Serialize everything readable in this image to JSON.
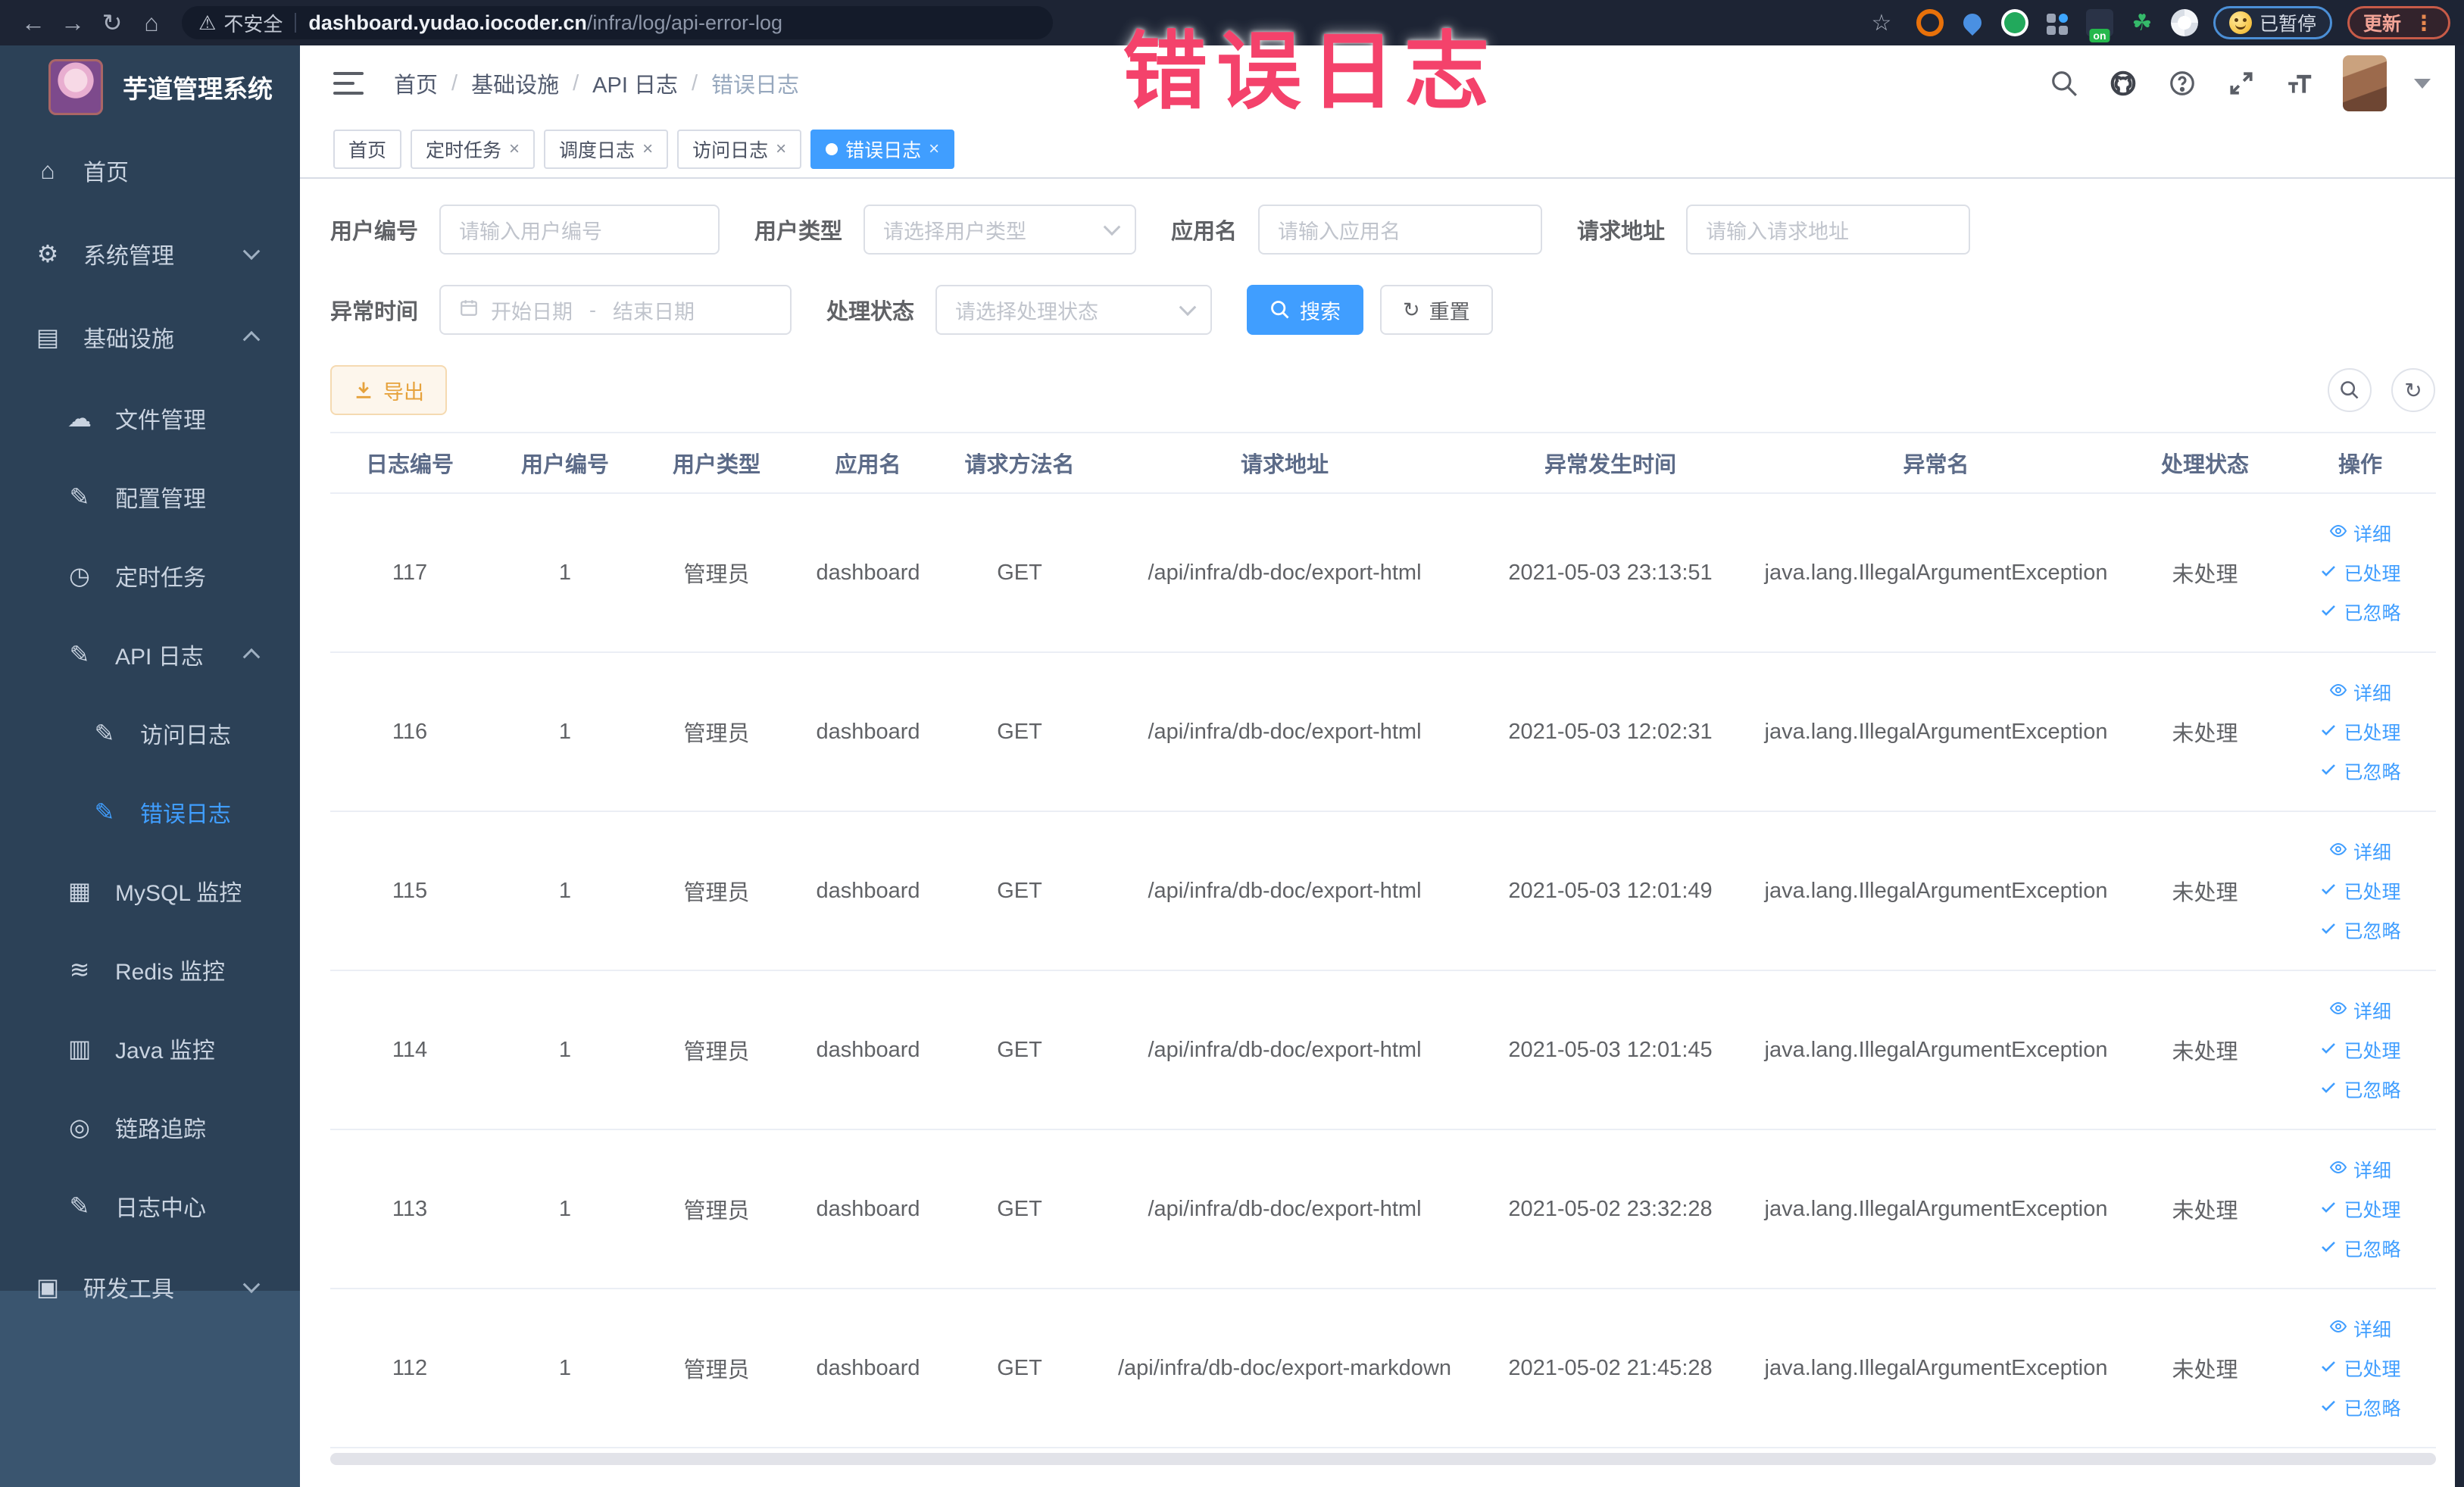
{
  "browser": {
    "security_label": "不安全",
    "url_domain": "dashboard.yudao.iocoder.cn",
    "url_path": "/infra/log/api-error-log",
    "paused_label": "已暂停",
    "update_label": "更新",
    "menu_dots": "⋮",
    "icons": [
      "back-icon",
      "forward-icon",
      "reload-icon",
      "home-icon",
      "warning-icon",
      "bookmark-star-icon",
      "extension-icons",
      "profile-avatar"
    ]
  },
  "overlay_title": "错误日志",
  "sidebar": {
    "title": "芋道管理系统",
    "items": [
      {
        "label": "首页",
        "icon": "home-icon",
        "glyph": "⌂",
        "level": 0
      },
      {
        "label": "系统管理",
        "icon": "gear-icon",
        "glyph": "⚙",
        "level": 0,
        "chevron": "down"
      },
      {
        "label": "基础设施",
        "icon": "monitor-icon",
        "glyph": "▤",
        "level": 0,
        "chevron": "up"
      },
      {
        "label": "文件管理",
        "icon": "cloud-upload-icon",
        "glyph": "☁",
        "level": 1
      },
      {
        "label": "配置管理",
        "icon": "edit-icon",
        "glyph": "✎",
        "level": 1
      },
      {
        "label": "定时任务",
        "icon": "clock-icon",
        "glyph": "◷",
        "level": 1
      },
      {
        "label": "API 日志",
        "icon": "log-icon",
        "glyph": "✎",
        "level": 1,
        "chevron": "up"
      },
      {
        "label": "访问日志",
        "icon": "log-icon",
        "glyph": "✎",
        "level": 2
      },
      {
        "label": "错误日志",
        "icon": "log-icon",
        "glyph": "✎",
        "level": 2,
        "active": true
      },
      {
        "label": "MySQL 监控",
        "icon": "database-icon",
        "glyph": "▦",
        "level": 1
      },
      {
        "label": "Redis 监控",
        "icon": "redis-icon",
        "glyph": "≋",
        "level": 1
      },
      {
        "label": "Java 监控",
        "icon": "java-monitor-icon",
        "glyph": "▥",
        "level": 1
      },
      {
        "label": "链路追踪",
        "icon": "trace-eye-icon",
        "glyph": "◎",
        "level": 1
      },
      {
        "label": "日志中心",
        "icon": "log-icon",
        "glyph": "✎",
        "level": 1
      },
      {
        "label": "研发工具",
        "icon": "toolbox-icon",
        "glyph": "▣",
        "level": 0,
        "chevron": "down",
        "section": "light"
      }
    ]
  },
  "header": {
    "breadcrumb": [
      "首页",
      "基础设施",
      "API 日志",
      "错误日志"
    ],
    "right_icons": [
      "search-icon",
      "github-icon",
      "help-icon",
      "fullscreen-icon",
      "font-size-icon",
      "avatar",
      "chevron-down-icon"
    ]
  },
  "tabs": [
    {
      "label": "首页",
      "closable": false,
      "active": false
    },
    {
      "label": "定时任务",
      "closable": true,
      "active": false
    },
    {
      "label": "调度日志",
      "closable": true,
      "active": false
    },
    {
      "label": "访问日志",
      "closable": true,
      "active": false
    },
    {
      "label": "错误日志",
      "closable": true,
      "active": true
    }
  ],
  "filters": {
    "user_id_label": "用户编号",
    "user_id_placeholder": "请输入用户编号",
    "user_type_label": "用户类型",
    "user_type_placeholder": "请选择用户类型",
    "app_name_label": "应用名",
    "app_name_placeholder": "请输入应用名",
    "request_url_label": "请求地址",
    "request_url_placeholder": "请输入请求地址",
    "exception_time_label": "异常时间",
    "date_start_placeholder": "开始日期",
    "date_range_separator": "-",
    "date_end_placeholder": "结束日期",
    "process_status_label": "处理状态",
    "process_status_placeholder": "请选择处理状态",
    "search_label": "搜索",
    "reset_label": "重置"
  },
  "toolbar": {
    "export_label": "导出"
  },
  "table": {
    "columns": [
      "日志编号",
      "用户编号",
      "用户类型",
      "应用名",
      "请求方法名",
      "请求地址",
      "异常发生时间",
      "异常名",
      "处理状态",
      "操作"
    ],
    "action_labels": [
      "详细",
      "已处理",
      "已忽略"
    ],
    "rows": [
      {
        "log_id": "117",
        "user_id": "1",
        "user_type": "管理员",
        "app_name": "dashboard",
        "method": "GET",
        "url": "/api/infra/db-doc/export-html",
        "time": "2021-05-03 23:13:51",
        "exception": "java.lang.IllegalArgumentException",
        "status": "未处理"
      },
      {
        "log_id": "116",
        "user_id": "1",
        "user_type": "管理员",
        "app_name": "dashboard",
        "method": "GET",
        "url": "/api/infra/db-doc/export-html",
        "time": "2021-05-03 12:02:31",
        "exception": "java.lang.IllegalArgumentException",
        "status": "未处理"
      },
      {
        "log_id": "115",
        "user_id": "1",
        "user_type": "管理员",
        "app_name": "dashboard",
        "method": "GET",
        "url": "/api/infra/db-doc/export-html",
        "time": "2021-05-03 12:01:49",
        "exception": "java.lang.IllegalArgumentException",
        "status": "未处理"
      },
      {
        "log_id": "114",
        "user_id": "1",
        "user_type": "管理员",
        "app_name": "dashboard",
        "method": "GET",
        "url": "/api/infra/db-doc/export-html",
        "time": "2021-05-03 12:01:45",
        "exception": "java.lang.IllegalArgumentException",
        "status": "未处理"
      },
      {
        "log_id": "113",
        "user_id": "1",
        "user_type": "管理员",
        "app_name": "dashboard",
        "method": "GET",
        "url": "/api/infra/db-doc/export-html",
        "time": "2021-05-02 23:32:28",
        "exception": "java.lang.IllegalArgumentException",
        "status": "未处理"
      },
      {
        "log_id": "112",
        "user_id": "1",
        "user_type": "管理员",
        "app_name": "dashboard",
        "method": "GET",
        "url": "/api/infra/db-doc/export-markdown",
        "time": "2021-05-02 21:45:28",
        "exception": "java.lang.IllegalArgumentException",
        "status": "未处理"
      }
    ]
  },
  "colors": {
    "accent_blue": "#409eff",
    "warning_orange": "#e6a23c",
    "sidebar_bg": "#2c4157",
    "sidebar_light_bg": "#3a556f",
    "browser_bar_bg": "#1d2434",
    "overlay_pink": "#f4426b"
  }
}
